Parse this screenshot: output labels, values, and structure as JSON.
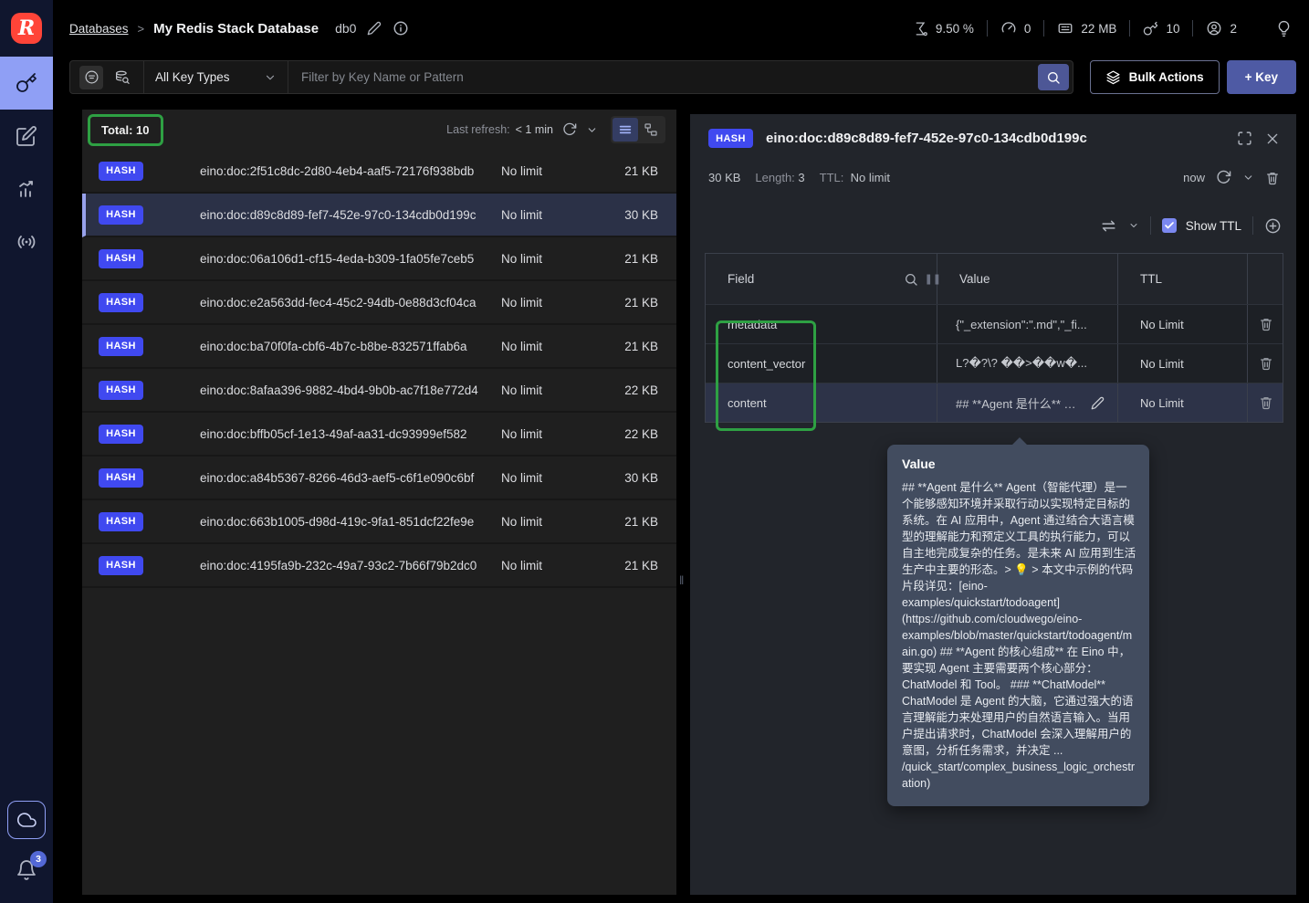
{
  "colors": {
    "accent_indigo": "#4049f0",
    "annotation_green": "#2ea043",
    "sidebar_active": "#8f9ff5",
    "redis_red": "#ff4438"
  },
  "sidebar": {
    "logo_letter": "R",
    "notification_count": "3"
  },
  "header": {
    "breadcrumb_link": "Databases",
    "breadcrumb_separator": ">",
    "db_title": "My Redis Stack Database",
    "db_index": "db0",
    "stats": {
      "cpu": "9.50 %",
      "commands": "0",
      "memory": "22 MB",
      "keys": "10",
      "clients": "2"
    }
  },
  "filter_bar": {
    "key_type": "All Key Types",
    "placeholder": "Filter by Key Name or Pattern",
    "bulk_actions": "Bulk Actions",
    "add_key": "+ Key"
  },
  "key_list": {
    "total": "Total: 10",
    "last_refresh_label": "Last refresh:",
    "last_refresh_value": "< 1 min",
    "rows": [
      {
        "type": "HASH",
        "name": "eino:doc:2f51c8dc-2d80-4eb4-aaf5-72176f938bdb",
        "ttl": "No limit",
        "size": "21 KB",
        "selected": false
      },
      {
        "type": "HASH",
        "name": "eino:doc:d89c8d89-fef7-452e-97c0-134cdb0d199c",
        "ttl": "No limit",
        "size": "30 KB",
        "selected": true
      },
      {
        "type": "HASH",
        "name": "eino:doc:06a106d1-cf15-4eda-b309-1fa05fe7ceb5",
        "ttl": "No limit",
        "size": "21 KB",
        "selected": false
      },
      {
        "type": "HASH",
        "name": "eino:doc:e2a563dd-fec4-45c2-94db-0e88d3cf04ca",
        "ttl": "No limit",
        "size": "21 KB",
        "selected": false
      },
      {
        "type": "HASH",
        "name": "eino:doc:ba70f0fa-cbf6-4b7c-b8be-832571ffab6a",
        "ttl": "No limit",
        "size": "21 KB",
        "selected": false
      },
      {
        "type": "HASH",
        "name": "eino:doc:8afaa396-9882-4bd4-9b0b-ac7f18e772d4",
        "ttl": "No limit",
        "size": "22 KB",
        "selected": false
      },
      {
        "type": "HASH",
        "name": "eino:doc:bffb05cf-1e13-49af-aa31-dc93999ef582",
        "ttl": "No limit",
        "size": "22 KB",
        "selected": false
      },
      {
        "type": "HASH",
        "name": "eino:doc:a84b5367-8266-46d3-aef5-c6f1e090c6bf",
        "ttl": "No limit",
        "size": "30 KB",
        "selected": false
      },
      {
        "type": "HASH",
        "name": "eino:doc:663b1005-d98d-419c-9fa1-851dcf22fe9e",
        "ttl": "No limit",
        "size": "21 KB",
        "selected": false
      },
      {
        "type": "HASH",
        "name": "eino:doc:4195fa9b-232c-49a7-93c2-7b66f79b2dc0",
        "ttl": "No limit",
        "size": "21 KB",
        "selected": false
      }
    ]
  },
  "details": {
    "type_badge": "HASH",
    "key_name": "eino:doc:d89c8d89-fef7-452e-97c0-134cdb0d199c",
    "size": "30 KB",
    "length_label": "Length:",
    "length_value": "3",
    "ttl_label": "TTL:",
    "ttl_value": "No limit",
    "refreshed": "now",
    "show_ttl": "Show TTL",
    "table": {
      "col_field": "Field",
      "col_value": "Value",
      "col_ttl": "TTL",
      "rows": [
        {
          "field": "metadata",
          "value": "{\"_extension\":\".md\",\"_fi...",
          "ttl": "No Limit",
          "highlighted": false,
          "editable": false
        },
        {
          "field": "content_vector",
          "value": "L?�?\\? ��>��w�...",
          "ttl": "No Limit",
          "highlighted": false,
          "editable": false
        },
        {
          "field": "content",
          "value": "## **Agent 是什么** A...",
          "ttl": "No Limit",
          "highlighted": true,
          "editable": true
        }
      ]
    },
    "tooltip": {
      "title": "Value",
      "body": "## **Agent 是什么** Agent（智能代理）是一个能够感知环境并采取行动以实现特定目标的系统。在 AI 应用中，Agent 通过结合大语言模型的理解能力和预定义工具的执行能力，可以自主地完成复杂的任务。是未来 AI 应用到生活生产中主要的形态。> 💡 > 本文中示例的代码片段详见：[eino-examples/quickstart/todoagent](https://github.com/cloudwego/eino-examples/blob/master/quickstart/todoagent/main.go) ## **Agent 的核心组成** 在 Eino 中，要实现 Agent 主要需要两个核心部分：ChatModel 和 Tool。 ### **ChatModel** ChatModel 是 Agent 的大脑，它通过强大的语言理解能力来处理用户的自然语言输入。当用户提出请求时，ChatModel 会深入理解用户的意图，分析任务需求，并决定 ... /quick_start/complex_business_logic_orchestration)"
    }
  }
}
